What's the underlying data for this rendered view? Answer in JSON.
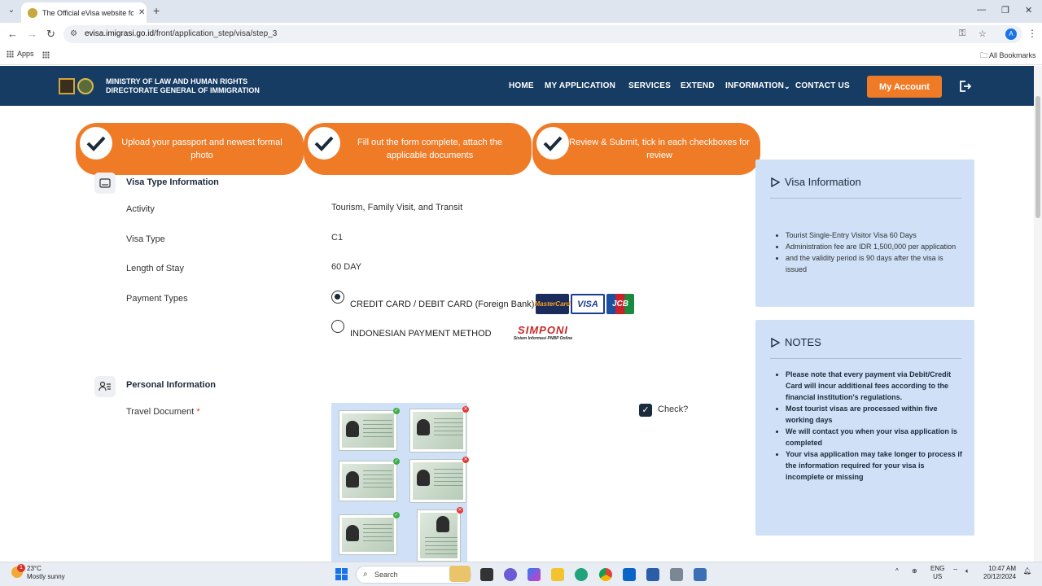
{
  "browser": {
    "tab_title": "The Official eVisa website for Im",
    "url_host": "evisa.imigrasi.go.id",
    "url_path": "/front/application_step/visa/step_3",
    "profile_initial": "A",
    "bookmarks": {
      "apps": "Apps",
      "all": "All Bookmarks"
    }
  },
  "header": {
    "ministry_line1": "MINISTRY OF  LAW  AND HUMAN RIGHTS",
    "ministry_line2": "DIRECTORATE GENERAL OF IMMIGRATION",
    "nav": [
      "HOME",
      "MY APPLICATION",
      "SERVICES",
      "EXTEND",
      "INFORMATION",
      "CONTACT US"
    ],
    "account_button": "My Account",
    "brand_color": "#163c63",
    "accent_color": "#f07b27"
  },
  "steps": [
    {
      "text": "Upload your passport and newest formal photo"
    },
    {
      "text": "Fill out the form complete, attach the applicable documents"
    },
    {
      "text": "Review & Submit, tick in each checkboxes for review"
    }
  ],
  "visa_type": {
    "section_title": "Visa Type Information",
    "fields": [
      {
        "label": "Activity",
        "value": "Tourism, Family Visit, and Transit"
      },
      {
        "label": "Visa Type",
        "value": "C1"
      },
      {
        "label": "Length of Stay",
        "value": "60 DAY"
      },
      {
        "label": "Payment Types",
        "value": ""
      }
    ],
    "payment_options": [
      {
        "label": "CREDIT CARD / DEBIT CARD (Foreign Bank)",
        "selected": true
      },
      {
        "label": "INDONESIAN PAYMENT METHOD",
        "selected": false
      }
    ],
    "card_logos": [
      "MasterCard",
      "VISA",
      "JCB"
    ],
    "simponi": {
      "main": "SIMPONI",
      "sub": "Sistem Informasi PNBP Online"
    }
  },
  "personal": {
    "section_title": "Personal Information",
    "travel_document_label": "Travel Document",
    "required_mark": "*",
    "check_label": "Check?",
    "check_checked": true
  },
  "visa_info": {
    "title": "Visa Information",
    "items": [
      "Tourist Single-Entry Visitor Visa 60 Days",
      "Administration fee are IDR 1,500,000 per application",
      "and the validity period is 90 days after the visa is issued"
    ]
  },
  "notes": {
    "title": "NOTES",
    "items": [
      "Please note that every payment via Debit/Credit Card will incur additional fees according to the financial institution's regulations.",
      "Most tourist visas are processed within five working days",
      "We will contact you when your visa application is completed",
      "Your visa application may take longer to process if the information required for your visa is incomplete or missing"
    ]
  },
  "taskbar": {
    "temperature": "23°C",
    "weather": "Mostly sunny",
    "weather_badge": "1",
    "search_label": "Search",
    "lang1": "ENG",
    "lang2": "US",
    "time": "10:47 AM",
    "date": "20/12/2024"
  }
}
